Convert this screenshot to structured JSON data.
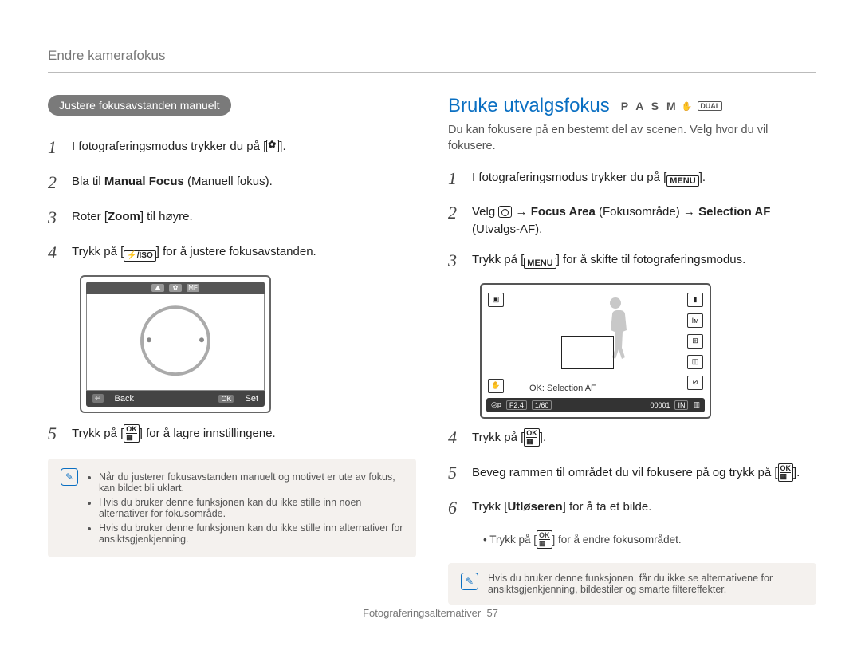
{
  "header": {
    "title": "Endre kamerafokus"
  },
  "left": {
    "badge": "Justere fokusavstanden manuelt",
    "steps": {
      "s1_pre": "I fotograferingsmodus trykker du på [",
      "s1_post": "].",
      "s2_a": "Bla til ",
      "s2_b1": "Manual Focus",
      "s2_c": " (Manuell fokus).",
      "s3_a": "Roter [",
      "s3_b": "Zoom",
      "s3_c": "] til høyre.",
      "s4_a": "Trykk på [",
      "s4_flash": "⚡/ISO",
      "s4_b": "] for å justere fokusavstanden.",
      "s5_a": "Trykk på [",
      "s5_b": "] for å lagre innstillingene."
    },
    "diagram": {
      "back": "Back",
      "set": "Set",
      "ok": "OK",
      "return": "↩",
      "mf": "MF",
      "flower": "✿",
      "near": "⛰"
    },
    "notes": {
      "n1": "Når du justerer fokusavstanden manuelt og motivet er ute av fokus, kan bildet bli uklart.",
      "n2": "Hvis du bruker denne funksjonen kan du ikke stille inn noen alternativer for fokusområde.",
      "n3": "Hvis du bruker denne funksjonen kan du ikke stille inn alternativer for ansiktsgjenkjenning."
    }
  },
  "right": {
    "title": "Bruke utvalgsfokus",
    "modes": "P A S M",
    "dual": "DUAL",
    "intro": "Du kan fokusere på en bestemt del av scenen. Velg hvor du vil fokusere.",
    "steps": {
      "s1_a": "I fotograferingsmodus trykker du på [",
      "s1_menu": "MENU",
      "s1_b": "].",
      "s2_a": "Velg ",
      "s2_b": " → ",
      "s2_c1": "Focus Area",
      "s2_c2": " (Fokusområde) → ",
      "s2_d1": "Selection AF",
      "s2_d2": " (Utvalgs-AF).",
      "s3_a": "Trykk på [",
      "s3_menu": "MENU",
      "s3_b": "] for å skifte til fotograferingsmodus.",
      "s4_a": "Trykk på [",
      "s4_b": "].",
      "s5": "Beveg rammen til området du vil fokusere på og trykk på [",
      "s5_b": "].",
      "s6_a": "Trykk [",
      "s6_b1": "Utløseren",
      "s6_b2": "] for å ta et bilde.",
      "sub": "Trykk på [",
      "sub_b": "] for å endre fokusområdet."
    },
    "camera": {
      "caption": "OK: Selection AF",
      "f": "F2.4",
      "shutter": "1/60",
      "count": "00001",
      "in": "IN"
    },
    "note": "Hvis du bruker denne funksjonen, får du ikke se alternativene for ansiktsgjenkjenning, bildestiler og smarte filtereffekter."
  },
  "ok_icon": {
    "top": "OK",
    "bot": "▦"
  },
  "footer": {
    "section": "Fotograferingsalternativer",
    "page": "57"
  }
}
